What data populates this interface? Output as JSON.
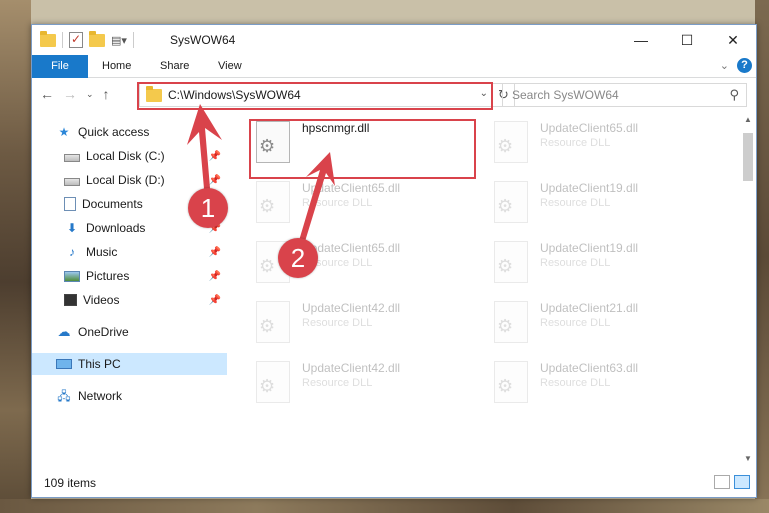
{
  "window": {
    "title": "SysWOW64",
    "controls": {
      "minimize": "—",
      "maximize": "☐",
      "close": "✕"
    }
  },
  "ribbon": {
    "tabs": [
      "File",
      "Home",
      "Share",
      "View"
    ]
  },
  "navigation": {
    "back": "←",
    "forward": "→",
    "recent": "⌄",
    "up": "↑",
    "address_path": "C:\\Windows\\SysWOW64",
    "refresh": "↻",
    "search_placeholder": "Search SysWOW64"
  },
  "sidebar": {
    "items": [
      {
        "label": "Quick access",
        "icon": "star-icon",
        "pinned": false
      },
      {
        "label": "Local Disk (C:)",
        "icon": "disk-icon",
        "pinned": true
      },
      {
        "label": "Local Disk (D:)",
        "icon": "disk-icon",
        "pinned": true
      },
      {
        "label": "Documents",
        "icon": "document-icon",
        "pinned": true
      },
      {
        "label": "Downloads",
        "icon": "download-icon",
        "pinned": true
      },
      {
        "label": "Music",
        "icon": "music-icon",
        "pinned": true
      },
      {
        "label": "Pictures",
        "icon": "pictures-icon",
        "pinned": true
      },
      {
        "label": "Videos",
        "icon": "video-icon",
        "pinned": true
      },
      {
        "label": "OneDrive",
        "icon": "cloud-icon",
        "pinned": false
      },
      {
        "label": "This PC",
        "icon": "computer-icon",
        "pinned": false,
        "selected": true
      },
      {
        "label": "Network",
        "icon": "network-icon",
        "pinned": false
      }
    ]
  },
  "files": [
    {
      "name": "hpscnmgr.dll",
      "type": ""
    },
    {
      "name": "UpdateClient65.dll",
      "type": "Resource DLL"
    },
    {
      "name": "UpdateClient65.dll",
      "type": "Resource DLL"
    },
    {
      "name": "UpdateClient19.dll",
      "type": "Resource DLL"
    },
    {
      "name": "UpdateClient65.dll",
      "type": "Resource DLL"
    },
    {
      "name": "UpdateClient19.dll",
      "type": "Resource DLL"
    },
    {
      "name": "UpdateClient42.dll",
      "type": "Resource DLL"
    },
    {
      "name": "UpdateClient21.dll",
      "type": "Resource DLL"
    },
    {
      "name": "UpdateClient42.dll",
      "type": "Resource DLL"
    },
    {
      "name": "UpdateClient63.dll",
      "type": "Resource DLL"
    }
  ],
  "status": {
    "item_count": "109 items"
  },
  "annotations": {
    "step1": "1",
    "step2": "2",
    "highlight_color": "#d9434b"
  }
}
